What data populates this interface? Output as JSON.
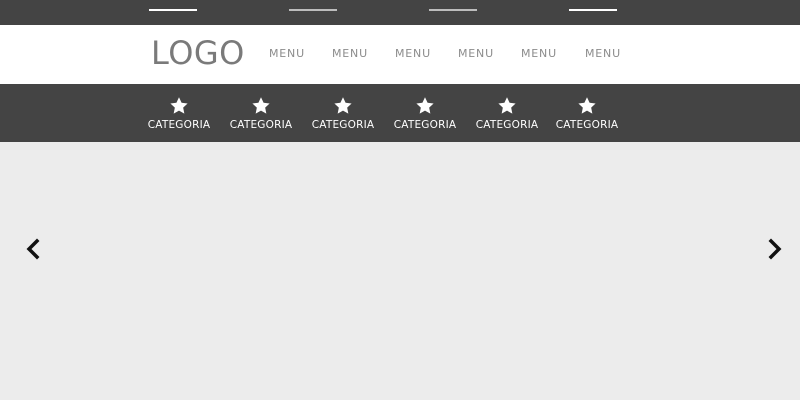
{
  "header": {
    "logo": "LOGO",
    "menu": [
      "MENU",
      "MENU",
      "MENU",
      "MENU",
      "MENU",
      "MENU"
    ]
  },
  "categories": {
    "items": [
      {
        "label": "CATEGORIA",
        "icon": "star-icon"
      },
      {
        "label": "CATEGORIA",
        "icon": "star-icon"
      },
      {
        "label": "CATEGORIA",
        "icon": "star-icon"
      },
      {
        "label": "CATEGORIA",
        "icon": "star-icon"
      },
      {
        "label": "CATEGORIA",
        "icon": "star-icon"
      },
      {
        "label": "CATEGORIA",
        "icon": "star-icon"
      }
    ]
  },
  "slider": {
    "prev_icon": "chevron-left-icon",
    "next_icon": "chevron-right-icon"
  },
  "colors": {
    "dark_bar": "#444444",
    "header_bg": "#ffffff",
    "slider_bg": "#ececec",
    "logo_text": "#7a7a7a",
    "menu_text": "#8c8c8c"
  }
}
